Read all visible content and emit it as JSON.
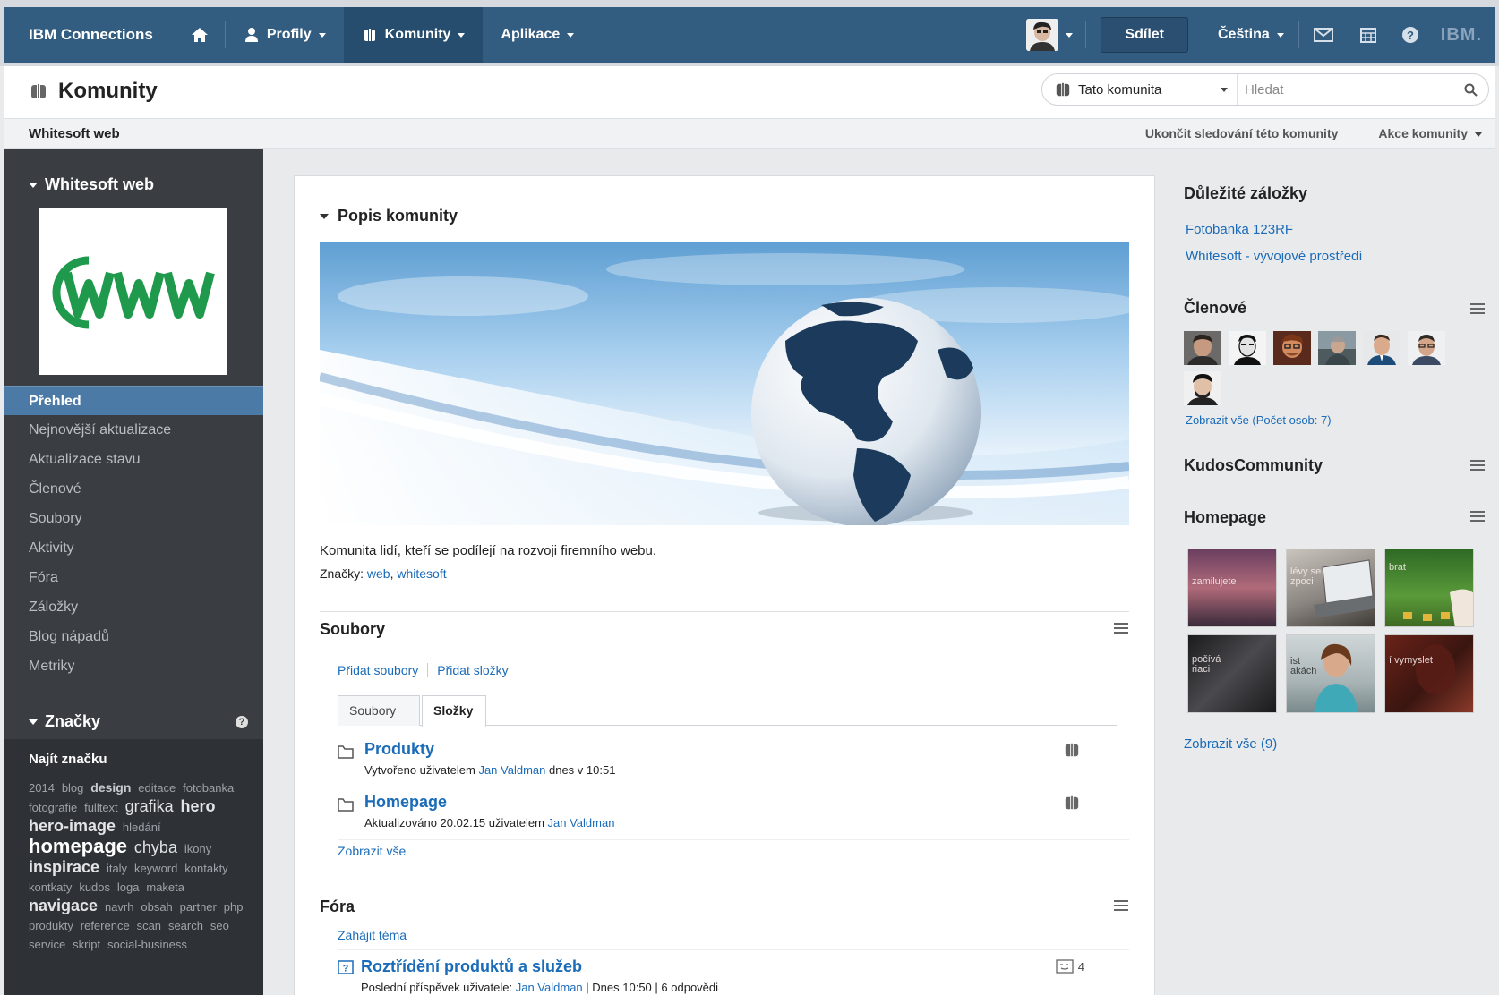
{
  "topnav": {
    "brand": "IBM Connections",
    "profiles": "Profily",
    "communities": "Komunity",
    "apps": "Aplikace",
    "share": "Sdílet",
    "language": "Čeština",
    "ibm_logo": "IBM."
  },
  "titlebar": {
    "title": "Komunity",
    "search_scope": "Tato komunita",
    "search_placeholder": "Hledat"
  },
  "community_bar": {
    "name": "Whitesoft web",
    "stop_following": "Ukončit sledování této komunity",
    "community_actions": "Akce komunity"
  },
  "sidebar": {
    "heading": "Whitesoft web",
    "nav": [
      "Přehled",
      "Nejnovější aktualizace",
      "Aktualizace stavu",
      "Členové",
      "Soubory",
      "Aktivity",
      "Fóra",
      "Záložky",
      "Blog nápadů",
      "Metriky"
    ],
    "tags_heading": "Značky",
    "find_tag": "Najít značku",
    "tags": [
      {
        "t": "2014",
        "s": 1
      },
      {
        "t": "blog",
        "s": 1
      },
      {
        "t": "design",
        "s": 2
      },
      {
        "t": "editace",
        "s": 1
      },
      {
        "t": "fotobanka",
        "s": 1
      },
      {
        "t": "fotografie",
        "s": 1
      },
      {
        "t": "fulltext",
        "s": 1
      },
      {
        "t": "grafika",
        "s": 5
      },
      {
        "t": "hero",
        "s": 3
      },
      {
        "t": "hero-image",
        "s": 3
      },
      {
        "t": "hledání",
        "s": 1
      },
      {
        "t": "homepage",
        "s": 4
      },
      {
        "t": "chyba",
        "s": 5
      },
      {
        "t": "ikony",
        "s": 1
      },
      {
        "t": "inspirace",
        "s": 3
      },
      {
        "t": "italy",
        "s": 1
      },
      {
        "t": "keyword",
        "s": 1
      },
      {
        "t": "kontakty",
        "s": 1
      },
      {
        "t": "kontkaty",
        "s": 1
      },
      {
        "t": "kudos",
        "s": 1
      },
      {
        "t": "loga",
        "s": 1
      },
      {
        "t": "maketa",
        "s": 1
      },
      {
        "t": "navigace",
        "s": 3
      },
      {
        "t": "navrh",
        "s": 1
      },
      {
        "t": "obsah",
        "s": 1
      },
      {
        "t": "partner",
        "s": 1
      },
      {
        "t": "php",
        "s": 1
      },
      {
        "t": "produkty",
        "s": 1
      },
      {
        "t": "reference",
        "s": 1
      },
      {
        "t": "scan",
        "s": 1
      },
      {
        "t": "search",
        "s": 1
      },
      {
        "t": "seo",
        "s": 1
      },
      {
        "t": "service",
        "s": 1
      },
      {
        "t": "skript",
        "s": 1
      },
      {
        "t": "social-business",
        "s": 1
      }
    ]
  },
  "main": {
    "description_heading": "Popis komunity",
    "description": "Komunita lidí, kteří se podílejí na rozvoji firemního webu.",
    "tags_label": "Značky:",
    "tag_links": [
      "web",
      "whitesoft"
    ],
    "files": {
      "title": "Soubory",
      "add_files": "Přidat soubory",
      "add_folders": "Přidat složky",
      "tab_files": "Soubory",
      "tab_folders": "Složky",
      "items": [
        {
          "name": "Produkty",
          "meta_prefix": "Vytvořeno uživatelem",
          "user": "Jan Valdman",
          "meta_suffix": "dnes v 10:51"
        },
        {
          "name": "Homepage",
          "meta_prefix": "Aktualizováno 20.02.15 uživatelem",
          "user": "Jan Valdman",
          "meta_suffix": ""
        }
      ],
      "show_all": "Zobrazit vše"
    },
    "forums": {
      "title": "Fóra",
      "start_topic": "Zahájit téma",
      "topic": "Roztřídění produktů a služeb",
      "meta_prefix": "Poslední příspěvek uživatele:",
      "user": "Jan Valdman",
      "time": "Dnes 10:50",
      "replies": "6 odpovědi",
      "count": "4"
    }
  },
  "right": {
    "bookmarks_title": "Důležité záložky",
    "bookmarks": [
      "Fotobanka 123RF",
      "Whitesoft - vývojové prostředí"
    ],
    "members_title": "Členové",
    "members_show_all": "Zobrazit vše (Počet osob: 7)",
    "kudos_title": "KudosCommunity",
    "homepage_title": "Homepage",
    "thumb_captions": [
      "zamilujete",
      "lévy se zpoci",
      "brat",
      "počívá riaci",
      "ist akách",
      "í vymyslet"
    ],
    "homepage_show_all": "Zobrazit vše (9)"
  },
  "colors": {
    "nav_bg": "#325c80",
    "sidebar_bg": "#3a3e43",
    "selected": "#4c7aa6",
    "link": "#1a6bb8"
  }
}
